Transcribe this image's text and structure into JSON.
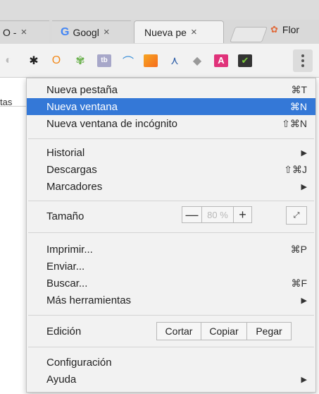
{
  "tabs": [
    {
      "label": "O -",
      "close": "×"
    },
    {
      "label": "Googl",
      "close": "×",
      "icon": "G"
    },
    {
      "label": "Nueva pe",
      "close": "×"
    },
    {
      "label": "Flor",
      "icon": "flower-icon"
    }
  ],
  "page": {
    "fragment": "tas"
  },
  "menu": {
    "new_tab": {
      "label": "Nueva pestaña",
      "shortcut": "⌘T"
    },
    "new_window": {
      "label": "Nueva ventana",
      "shortcut": "⌘N"
    },
    "new_incognito": {
      "label": "Nueva ventana de incógnito",
      "shortcut": "⇧⌘N"
    },
    "history": {
      "label": "Historial",
      "arrow": "▶"
    },
    "downloads": {
      "label": "Descargas",
      "shortcut": "⇧⌘J"
    },
    "bookmarks": {
      "label": "Marcadores",
      "arrow": "▶"
    },
    "zoom": {
      "label": "Tamaño",
      "minus": "—",
      "value": "80 %",
      "plus": "+",
      "fullscreen": "⤢"
    },
    "print": {
      "label": "Imprimir...",
      "shortcut": "⌘P"
    },
    "cast": {
      "label": "Enviar..."
    },
    "find": {
      "label": "Buscar...",
      "shortcut": "⌘F"
    },
    "more_tools": {
      "label": "Más herramientas",
      "arrow": "▶"
    },
    "edit": {
      "label": "Edición",
      "cut": "Cortar",
      "copy": "Copiar",
      "paste": "Pegar"
    },
    "settings": {
      "label": "Configuración"
    },
    "help": {
      "label": "Ayuda",
      "arrow": "▶"
    }
  },
  "colors": {
    "highlight": "#3478d7"
  }
}
